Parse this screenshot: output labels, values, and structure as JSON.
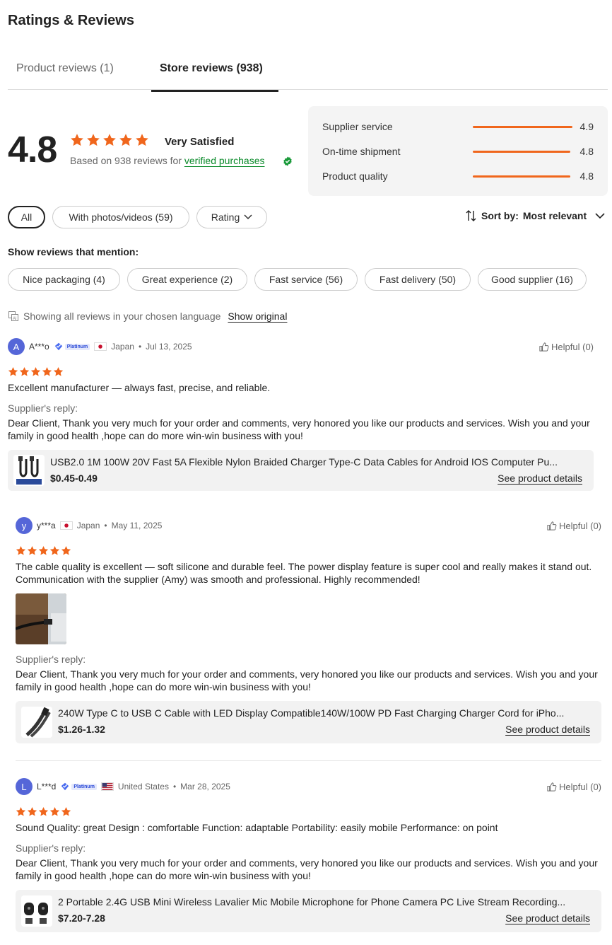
{
  "title": "Ratings & Reviews",
  "tabs": [
    {
      "label": "Product reviews (1)"
    },
    {
      "label": "Store reviews (938)"
    }
  ],
  "summary": {
    "score": "4.8",
    "stars": 5,
    "verdict": "Very Satisfied",
    "based_prefix": "Based on 938 reviews for ",
    "verified_link": "verified purchases"
  },
  "supplier": [
    {
      "label": "Supplier service",
      "value": "4.9",
      "level": 0.98
    },
    {
      "label": "On-time shipment",
      "value": "4.8",
      "level": 0.96
    },
    {
      "label": "Product quality",
      "value": "4.8",
      "level": 0.96
    }
  ],
  "filters": {
    "all": "All",
    "photos": "With photos/videos (59)",
    "rating": "Rating",
    "sort_prefix": "Sort by:",
    "sort_value": "Most relevant"
  },
  "mentions": {
    "title": "Show reviews that mention:",
    "chips": [
      "Nice packaging (4)",
      "Great experience (2)",
      "Fast service (56)",
      "Fast delivery (50)",
      "Good supplier (16)"
    ]
  },
  "language": {
    "text": "Showing all reviews in your chosen language",
    "link": "Show original"
  },
  "reviews": [
    {
      "avatar": "A",
      "user": "A***o",
      "platinum": "Platinum",
      "country": "Japan",
      "date": "Jul 13, 2025",
      "helpful": "Helpful (0)",
      "text": "Excellent manufacturer — always fast, precise, and reliable.",
      "reply_header": "Supplier's reply:",
      "reply": "Dear Client, Thank you very much for your order and comments, very honored you like our products and services. Wish you and your family in good health ,hope can do more win-win business with you!",
      "product": "USB2.0 1M 100W 20V Fast 5A Flexible Nylon Braided Charger Type-C Data Cables for Android IOS Computer Pu...",
      "price": "$0.45-0.49",
      "see": "See product details"
    },
    {
      "avatar": "y",
      "user": "y***a",
      "country": "Japan",
      "date": "May 11, 2025",
      "helpful": "Helpful (0)",
      "text": "The cable quality is excellent — soft silicone and durable feel. The power display feature is super cool and really makes it stand out. Communication with the supplier (Amy) was smooth and professional. Highly recommended!",
      "reply_header": "Supplier's reply:",
      "reply": "Dear Client, Thank you very much for your order and comments, very honored you like our products and services. Wish you and your family in good health ,hope can do more win-win business with you!",
      "product": "240W Type C to USB C Cable with LED Display Compatible140W/100W PD Fast Charging Charger Cord for iPho...",
      "price": "$1.26-1.32",
      "see": "See product details"
    },
    {
      "avatar": "L",
      "user": "L***d",
      "platinum": "Platinum",
      "country": "United States",
      "date": "Mar 28, 2025",
      "helpful": "Helpful (0)",
      "text": "Sound Quality: great Design : comfortable Function: adaptable Portability: easily mobile Performance: on point",
      "reply_header": "Supplier's reply:",
      "reply": "Dear Client, Thank you very much for your order and comments, very honored you like our products and services. Wish you and your family in good health ,hope can do more win-win business with you!",
      "product": "2 Portable 2.4G USB Mini Wireless Lavalier Mic Mobile Microphone for Phone Camera PC Live Stream Recording...",
      "price": "$7.20-7.28",
      "see": "See product details"
    }
  ],
  "colors": {
    "accent": "#f0661c",
    "verified": "#0a8a2a",
    "avatar": "#5566d8",
    "platinum": "#2c4bd8"
  }
}
